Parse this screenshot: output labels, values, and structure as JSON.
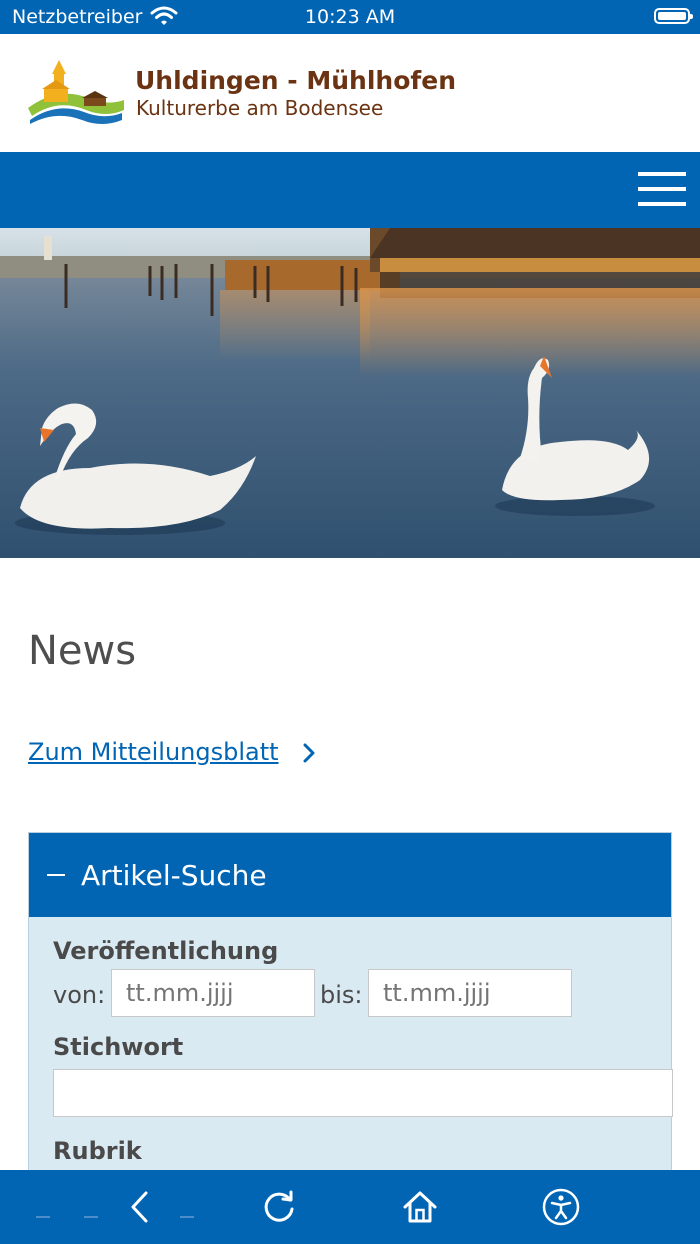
{
  "status_bar": {
    "carrier": "Netzbetreiber",
    "time": "10:23 AM"
  },
  "header": {
    "title": "Uhldingen - Mühlhofen",
    "subtitle": "Kulturerbe am Bodensee"
  },
  "main": {
    "heading": "News",
    "link_text": "Zum Mitteilungsblatt"
  },
  "search": {
    "header_label": "Artikel-Suche",
    "publication_label": "Veröffentlichung",
    "from_label": "von:",
    "from_placeholder": "tt.mm.jjjj",
    "to_label": "bis:",
    "to_placeholder": "tt.mm.jjjj",
    "keyword_label": "Stichwort",
    "keyword_value": "",
    "category_label": "Rubrik"
  },
  "colors": {
    "brand_blue": "#0165b4",
    "title_brown": "#6b3311",
    "panel_bg": "#daeaf3"
  },
  "icons": [
    "wifi-icon",
    "battery-icon",
    "logo",
    "menu-icon",
    "chevron-right-icon",
    "minus-icon",
    "back-icon",
    "reload-icon",
    "home-icon",
    "accessibility-icon"
  ]
}
